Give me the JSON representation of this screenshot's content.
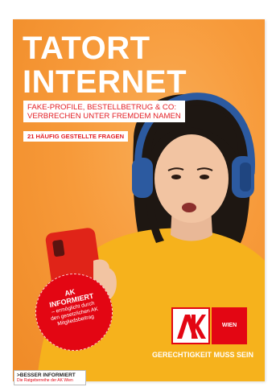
{
  "cover": {
    "title_line1": "TATORT",
    "title_line2": "INTERNET",
    "subtitle_line1": "FAKE-PROFILE, BESTELLBETRUG & CO:",
    "subtitle_line2": "VERBRECHEN UNTER FREMDEM NAMEN",
    "faq_label": "21 HÄUFIG GESTELLTE FRAGEN"
  },
  "badge": {
    "line1": "AK",
    "line2": "INFORMIERT",
    "line3": "– ermöglicht durch",
    "line4": "den gesetzlichen AK",
    "line5": "Mitgliedsbeitrag"
  },
  "ak": {
    "logo_text": "AK",
    "wien": "WIEN",
    "slogan": "GERECHTIGKEIT MUSS SEIN"
  },
  "series": {
    "name": ">BESSER INFORMIERT",
    "tagline": "Die Ratgeberreihe der AK Wien"
  },
  "colors": {
    "background": "#f79a3a",
    "ak_red": "#e30613",
    "subtitle_red": "#e31e24",
    "sweater": "#f6b21c",
    "headphones": "#2c5aa0",
    "phone": "#e02418"
  }
}
